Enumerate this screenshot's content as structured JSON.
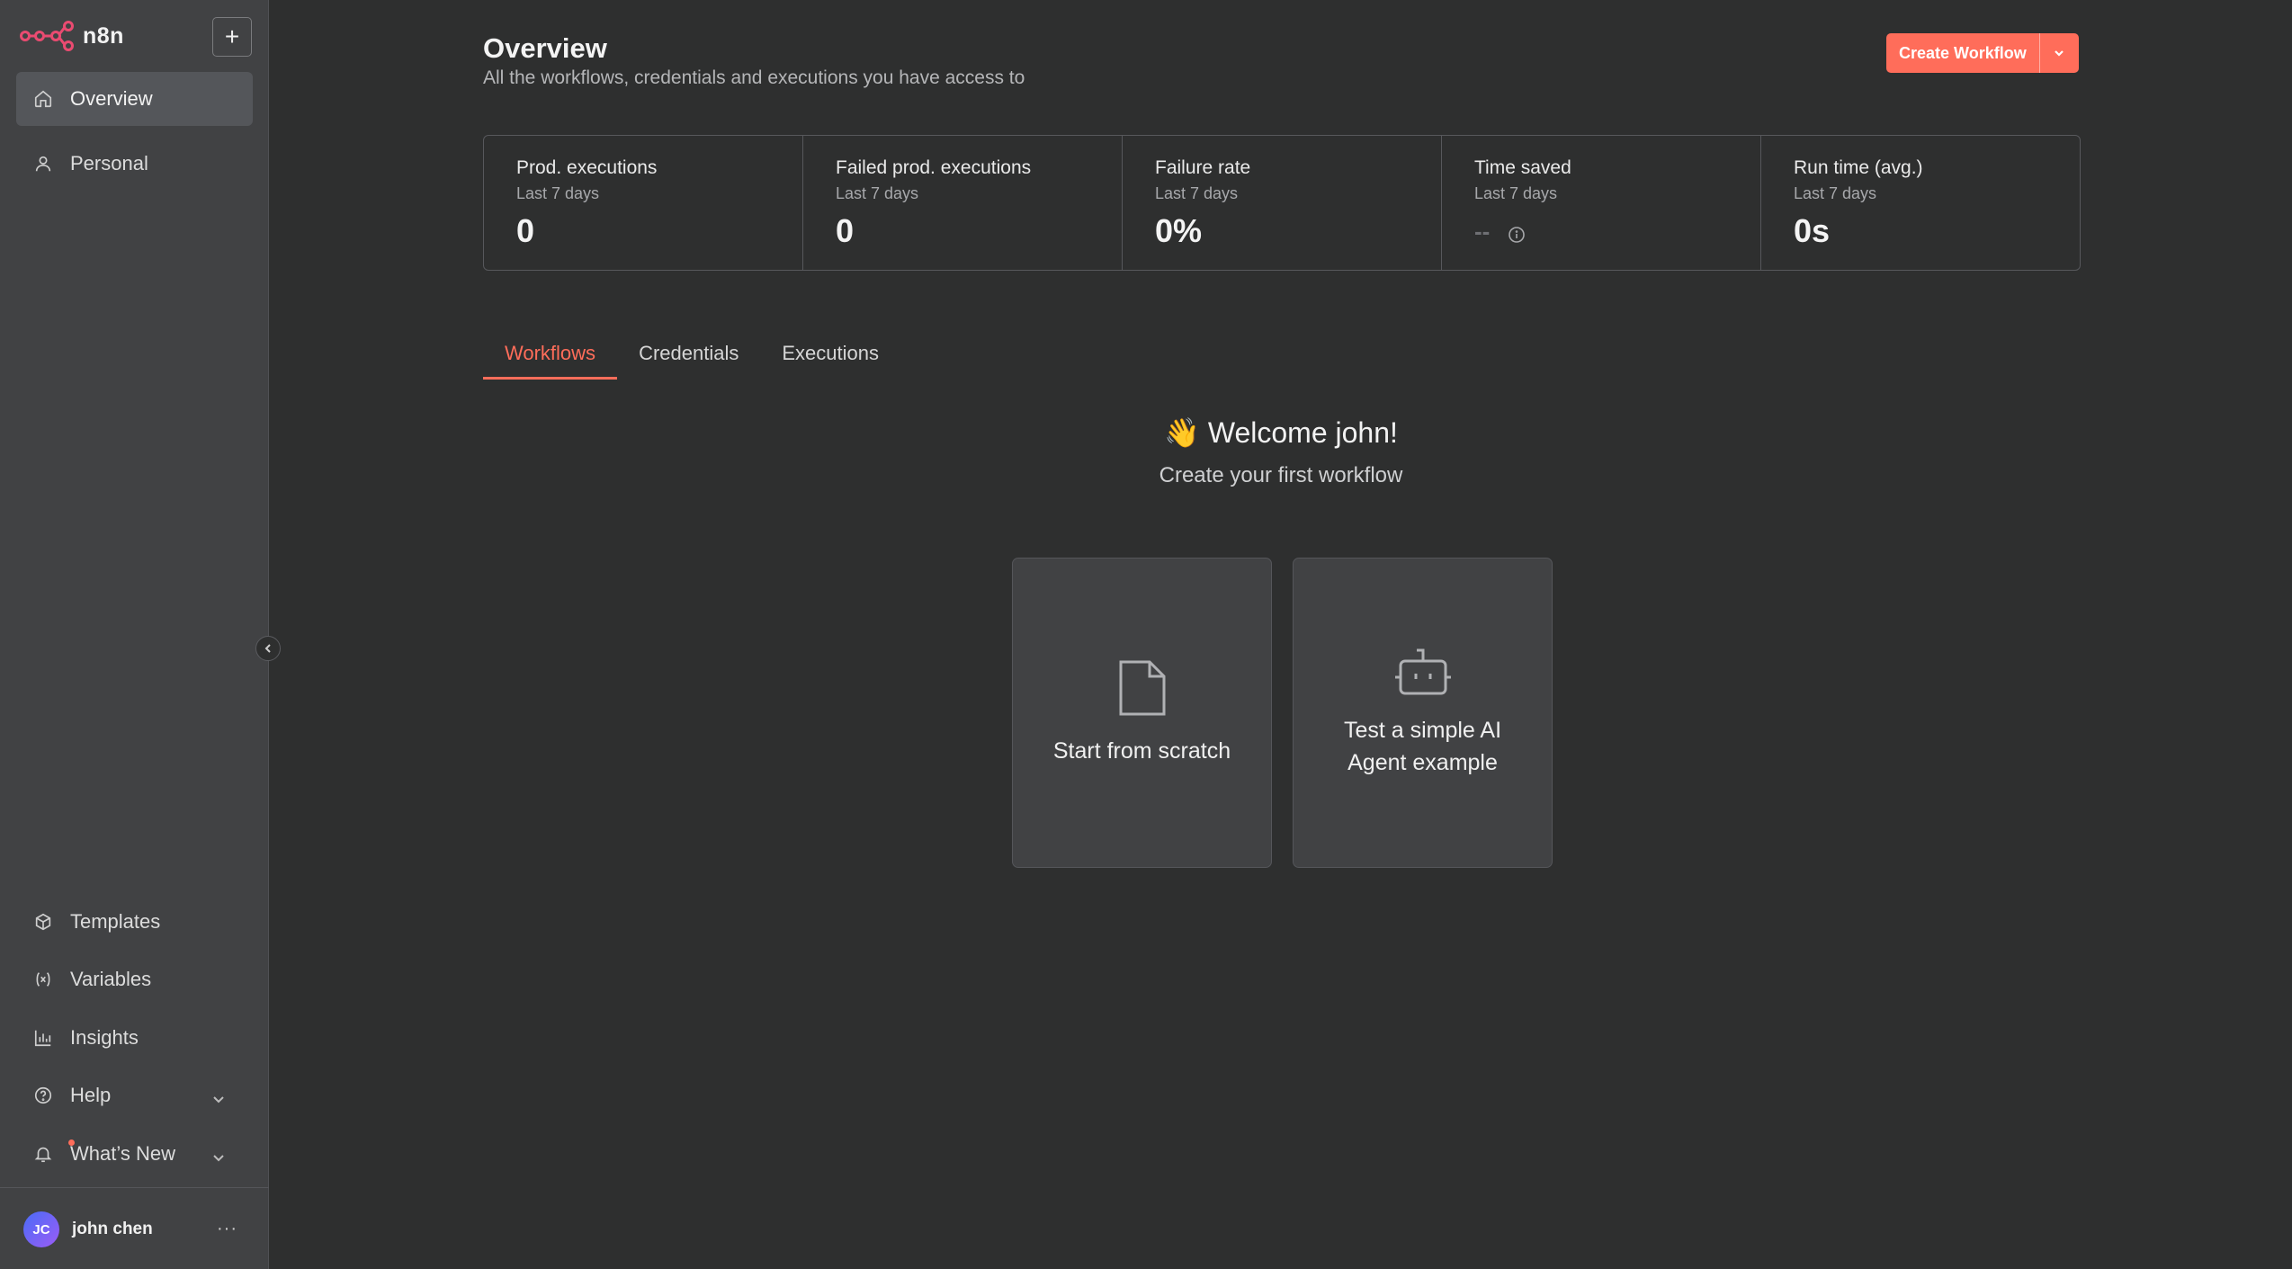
{
  "app": {
    "name": "n8n"
  },
  "sidebar": {
    "add_label": "+",
    "top_items": [
      {
        "label": "Overview",
        "icon": "home-icon",
        "active": true
      },
      {
        "label": "Personal",
        "icon": "user-icon",
        "active": false
      }
    ],
    "bottom_items": [
      {
        "label": "Templates",
        "icon": "templates-icon"
      },
      {
        "label": "Variables",
        "icon": "variables-icon"
      },
      {
        "label": "Insights",
        "icon": "insights-icon"
      },
      {
        "label": "Help",
        "icon": "help-icon"
      },
      {
        "label": "What’s New",
        "icon": "bell-icon"
      }
    ],
    "user": {
      "initials": "JC",
      "name": "john chen",
      "menu": "···"
    }
  },
  "header": {
    "title": "Overview",
    "subtitle": "All the workflows, credentials and executions you have access to",
    "create_label": "Create Workflow"
  },
  "stats": [
    {
      "label": "Prod. executions",
      "period": "Last 7 days",
      "value": "0"
    },
    {
      "label": "Failed prod. executions",
      "period": "Last 7 days",
      "value": "0"
    },
    {
      "label": "Failure rate",
      "period": "Last 7 days",
      "value": "0%"
    },
    {
      "label": "Time saved",
      "period": "Last 7 days",
      "value": "--"
    },
    {
      "label": "Run time (avg.)",
      "period": "Last 7 days",
      "value": "0s"
    }
  ],
  "tabs": [
    "Workflows",
    "Credentials",
    "Executions"
  ],
  "welcome": {
    "title": "👋 Welcome john!",
    "subtitle": "Create your first workflow"
  },
  "cards": [
    {
      "label": "Start from scratch",
      "icon": "file-icon"
    },
    {
      "label": "Test a simple AI Agent example",
      "icon": "robot-icon"
    }
  ],
  "colors": {
    "accent": "#ff6d5a",
    "background": "#2e2f2f",
    "sidebar": "#414244"
  }
}
